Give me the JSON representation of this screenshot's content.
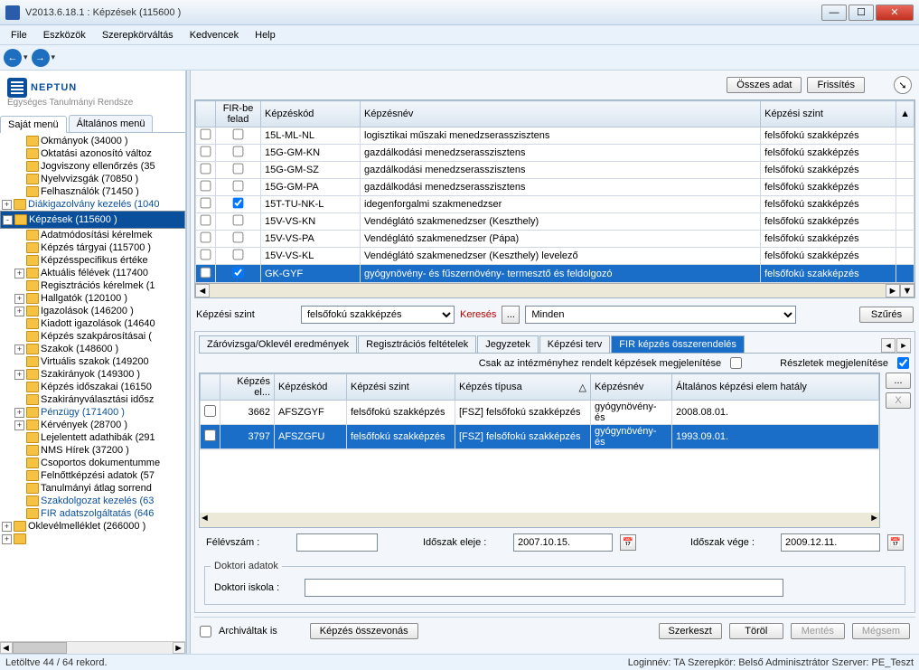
{
  "window": {
    "title": "V2013.6.18.1 : Képzések (115600  )"
  },
  "menu": {
    "items": [
      "File",
      "Eszközök",
      "Szerepkörváltás",
      "Kedvencek",
      "Help"
    ]
  },
  "brand": {
    "name": "NEPTUN",
    "sub": "Egységes Tanulmányi Rendsze"
  },
  "left_tabs": {
    "own": "Saját menü",
    "general": "Általános menü"
  },
  "tree": [
    {
      "lvl": 1,
      "exp": "",
      "text": "Okmányok (34000  )"
    },
    {
      "lvl": 1,
      "exp": "",
      "text": "Oktatási azonosító változ"
    },
    {
      "lvl": 1,
      "exp": "",
      "text": "Jogviszony ellenőrzés (35"
    },
    {
      "lvl": 1,
      "exp": "",
      "text": "Nyelvvizsgák (70850  )"
    },
    {
      "lvl": 1,
      "exp": "",
      "text": "Felhasználók (71450  )"
    },
    {
      "lvl": 0,
      "exp": "+",
      "text": "Diákigazolvány kezelés (1040",
      "link": true
    },
    {
      "lvl": 0,
      "exp": "-",
      "text": "Képzések (115600  )",
      "sel": true
    },
    {
      "lvl": 1,
      "exp": "",
      "text": "Adatmódosítási kérelmek"
    },
    {
      "lvl": 1,
      "exp": "",
      "text": "Képzés tárgyai (115700  )"
    },
    {
      "lvl": 1,
      "exp": "",
      "text": "Képzésspecifikus értéke"
    },
    {
      "lvl": 1,
      "exp": "+",
      "text": "Aktuális félévek (117400"
    },
    {
      "lvl": 1,
      "exp": "",
      "text": "Regisztrációs kérelmek (1"
    },
    {
      "lvl": 1,
      "exp": "+",
      "text": "Hallgatók (120100  )"
    },
    {
      "lvl": 1,
      "exp": "+",
      "text": "Igazolások (146200  )"
    },
    {
      "lvl": 1,
      "exp": "",
      "text": "Kiadott igazolások (14640"
    },
    {
      "lvl": 1,
      "exp": "",
      "text": "Képzés szakpárosításai ("
    },
    {
      "lvl": 1,
      "exp": "+",
      "text": "Szakok (148600  )"
    },
    {
      "lvl": 1,
      "exp": "",
      "text": "Virtuális szakok (149200"
    },
    {
      "lvl": 1,
      "exp": "+",
      "text": "Szakirányok (149300  )"
    },
    {
      "lvl": 1,
      "exp": "",
      "text": "Képzés időszakai (16150"
    },
    {
      "lvl": 1,
      "exp": "",
      "text": "Szakirányválasztási idősz"
    },
    {
      "lvl": 1,
      "exp": "+",
      "text": "Pénzügy (171400  )",
      "link": true
    },
    {
      "lvl": 1,
      "exp": "+",
      "text": "Kérvények (28700  )"
    },
    {
      "lvl": 1,
      "exp": "",
      "text": "Lejelentett adathibák (291"
    },
    {
      "lvl": 1,
      "exp": "",
      "text": "NMS Hírek (37200  )"
    },
    {
      "lvl": 1,
      "exp": "",
      "text": "Csoportos dokumentumme"
    },
    {
      "lvl": 1,
      "exp": "",
      "text": "Felnőttképzési adatok (57"
    },
    {
      "lvl": 1,
      "exp": "",
      "text": "Tanulmányi átlag sorrend"
    },
    {
      "lvl": 1,
      "exp": "",
      "text": "Szakdolgozat kezelés (63",
      "link": true
    },
    {
      "lvl": 1,
      "exp": "",
      "text": "FIR adatszolgáltatás (646",
      "link": true
    },
    {
      "lvl": 0,
      "exp": "+",
      "text": "Oklevélmelléklet (266000  )"
    },
    {
      "lvl": 0,
      "exp": "+",
      "text": ""
    }
  ],
  "top_buttons": {
    "all": "Összes adat",
    "refresh": "Frissítés"
  },
  "grid_headers": {
    "c1": "",
    "c2": "FIR-be felad",
    "c3": "Képzéskód",
    "c4": "Képzésnév",
    "c5": "Képzési szint"
  },
  "grid_rows": [
    {
      "ck": false,
      "ck2": false,
      "kod": "15L-ML-NL",
      "nev": "logisztikai műszaki menedzserasszisztens",
      "szint": "felsőfokú szakképzés"
    },
    {
      "ck": false,
      "ck2": false,
      "kod": "15G-GM-KN",
      "nev": "gazdálkodási menedzserasszisztens",
      "szint": "felsőfokú szakképzés"
    },
    {
      "ck": false,
      "ck2": false,
      "kod": "15G-GM-SZ",
      "nev": "gazdálkodási menedzserasszisztens",
      "szint": "felsőfokú szakképzés"
    },
    {
      "ck": false,
      "ck2": false,
      "kod": "15G-GM-PA",
      "nev": "gazdálkodási menedzserasszisztens",
      "szint": "felsőfokú szakképzés"
    },
    {
      "ck": false,
      "ck2": true,
      "kod": "15T-TU-NK-L",
      "nev": "idegenforgalmi szakmenedzser",
      "szint": "felsőfokú szakképzés"
    },
    {
      "ck": false,
      "ck2": false,
      "kod": "15V-VS-KN",
      "nev": "Vendéglátó szakmenedzser (Keszthely)",
      "szint": "felsőfokú szakképzés"
    },
    {
      "ck": false,
      "ck2": false,
      "kod": "15V-VS-PA",
      "nev": "Vendéglátó szakmenedzser (Pápa)",
      "szint": "felsőfokú szakképzés"
    },
    {
      "ck": false,
      "ck2": false,
      "kod": "15V-VS-KL",
      "nev": "Vendéglátó szakmenedzser (Keszthely) levelező",
      "szint": "felsőfokú szakképzés"
    },
    {
      "ck": false,
      "ck2": true,
      "kod": "GK-GYF",
      "nev": "gyógynövény- és fűszernövény- termesztő és feldolgozó",
      "szint": "felsőfokú szakképzés",
      "sel": true
    }
  ],
  "filter": {
    "label": "Képzési szint",
    "level": "felsőfokú szakképzés",
    "search": "Keresés",
    "dots": "...",
    "all": "Minden",
    "szures": "Szűrés"
  },
  "subtabs": {
    "t1": "Záróvizsga/Oklevél eredmények",
    "t2": "Regisztrációs feltételek",
    "t3": "Jegyzetek",
    "t4": "Képzési terv",
    "t5": "FIR képzés összerendelés"
  },
  "chk": {
    "only_inst": "Csak az intézményhez rendelt képzések megjelenítése",
    "details": "Részletek megjelenítése"
  },
  "grid2_headers": {
    "h0": "",
    "h1": "Képzés el...",
    "h2": "Képzéskód",
    "h3": "Képzési szint",
    "h4": "Képzés típusa",
    "h5": "Képzésnév",
    "h6": "Általános képzési elem hatály"
  },
  "grid2_rows": [
    {
      "ck": false,
      "el": "3662",
      "kod": "AFSZGYF",
      "szint": "felsőfokú szakképzés",
      "tipus": "[FSZ] felsőfokú szakképzés",
      "nev": "gyógynövény- és",
      "hat": "2008.08.01."
    },
    {
      "ck": false,
      "el": "3797",
      "kod": "AFSZGFU",
      "szint": "felsőfokú szakképzés",
      "tipus": "[FSZ] felsőfokú szakképzés",
      "nev": "gyógynövény- és",
      "hat": "1993.09.01.",
      "sel": true
    }
  ],
  "side": {
    "dots": "...",
    "x": "X"
  },
  "form": {
    "felev": "Félévszám :",
    "ido_eleje": "Időszak eleje :",
    "ido_eleje_v": "2007.10.15.",
    "ido_vege": "Időszak vége :",
    "ido_vege_v": "2009.12.11.",
    "doktori_group": "Doktori adatok",
    "doktori_iskola": "Doktori iskola :"
  },
  "bottom": {
    "arch": "Archiváltak is",
    "merge": "Képzés összevonás",
    "edit": "Szerkeszt",
    "del": "Töröl",
    "save": "Mentés",
    "cancel": "Mégsem"
  },
  "status": {
    "left": "Letöltve 44 / 64 rekord.",
    "right": "Loginnév: TA   Szerepkör: Belső Adminisztrátor   Szerver: PE_Teszt"
  }
}
